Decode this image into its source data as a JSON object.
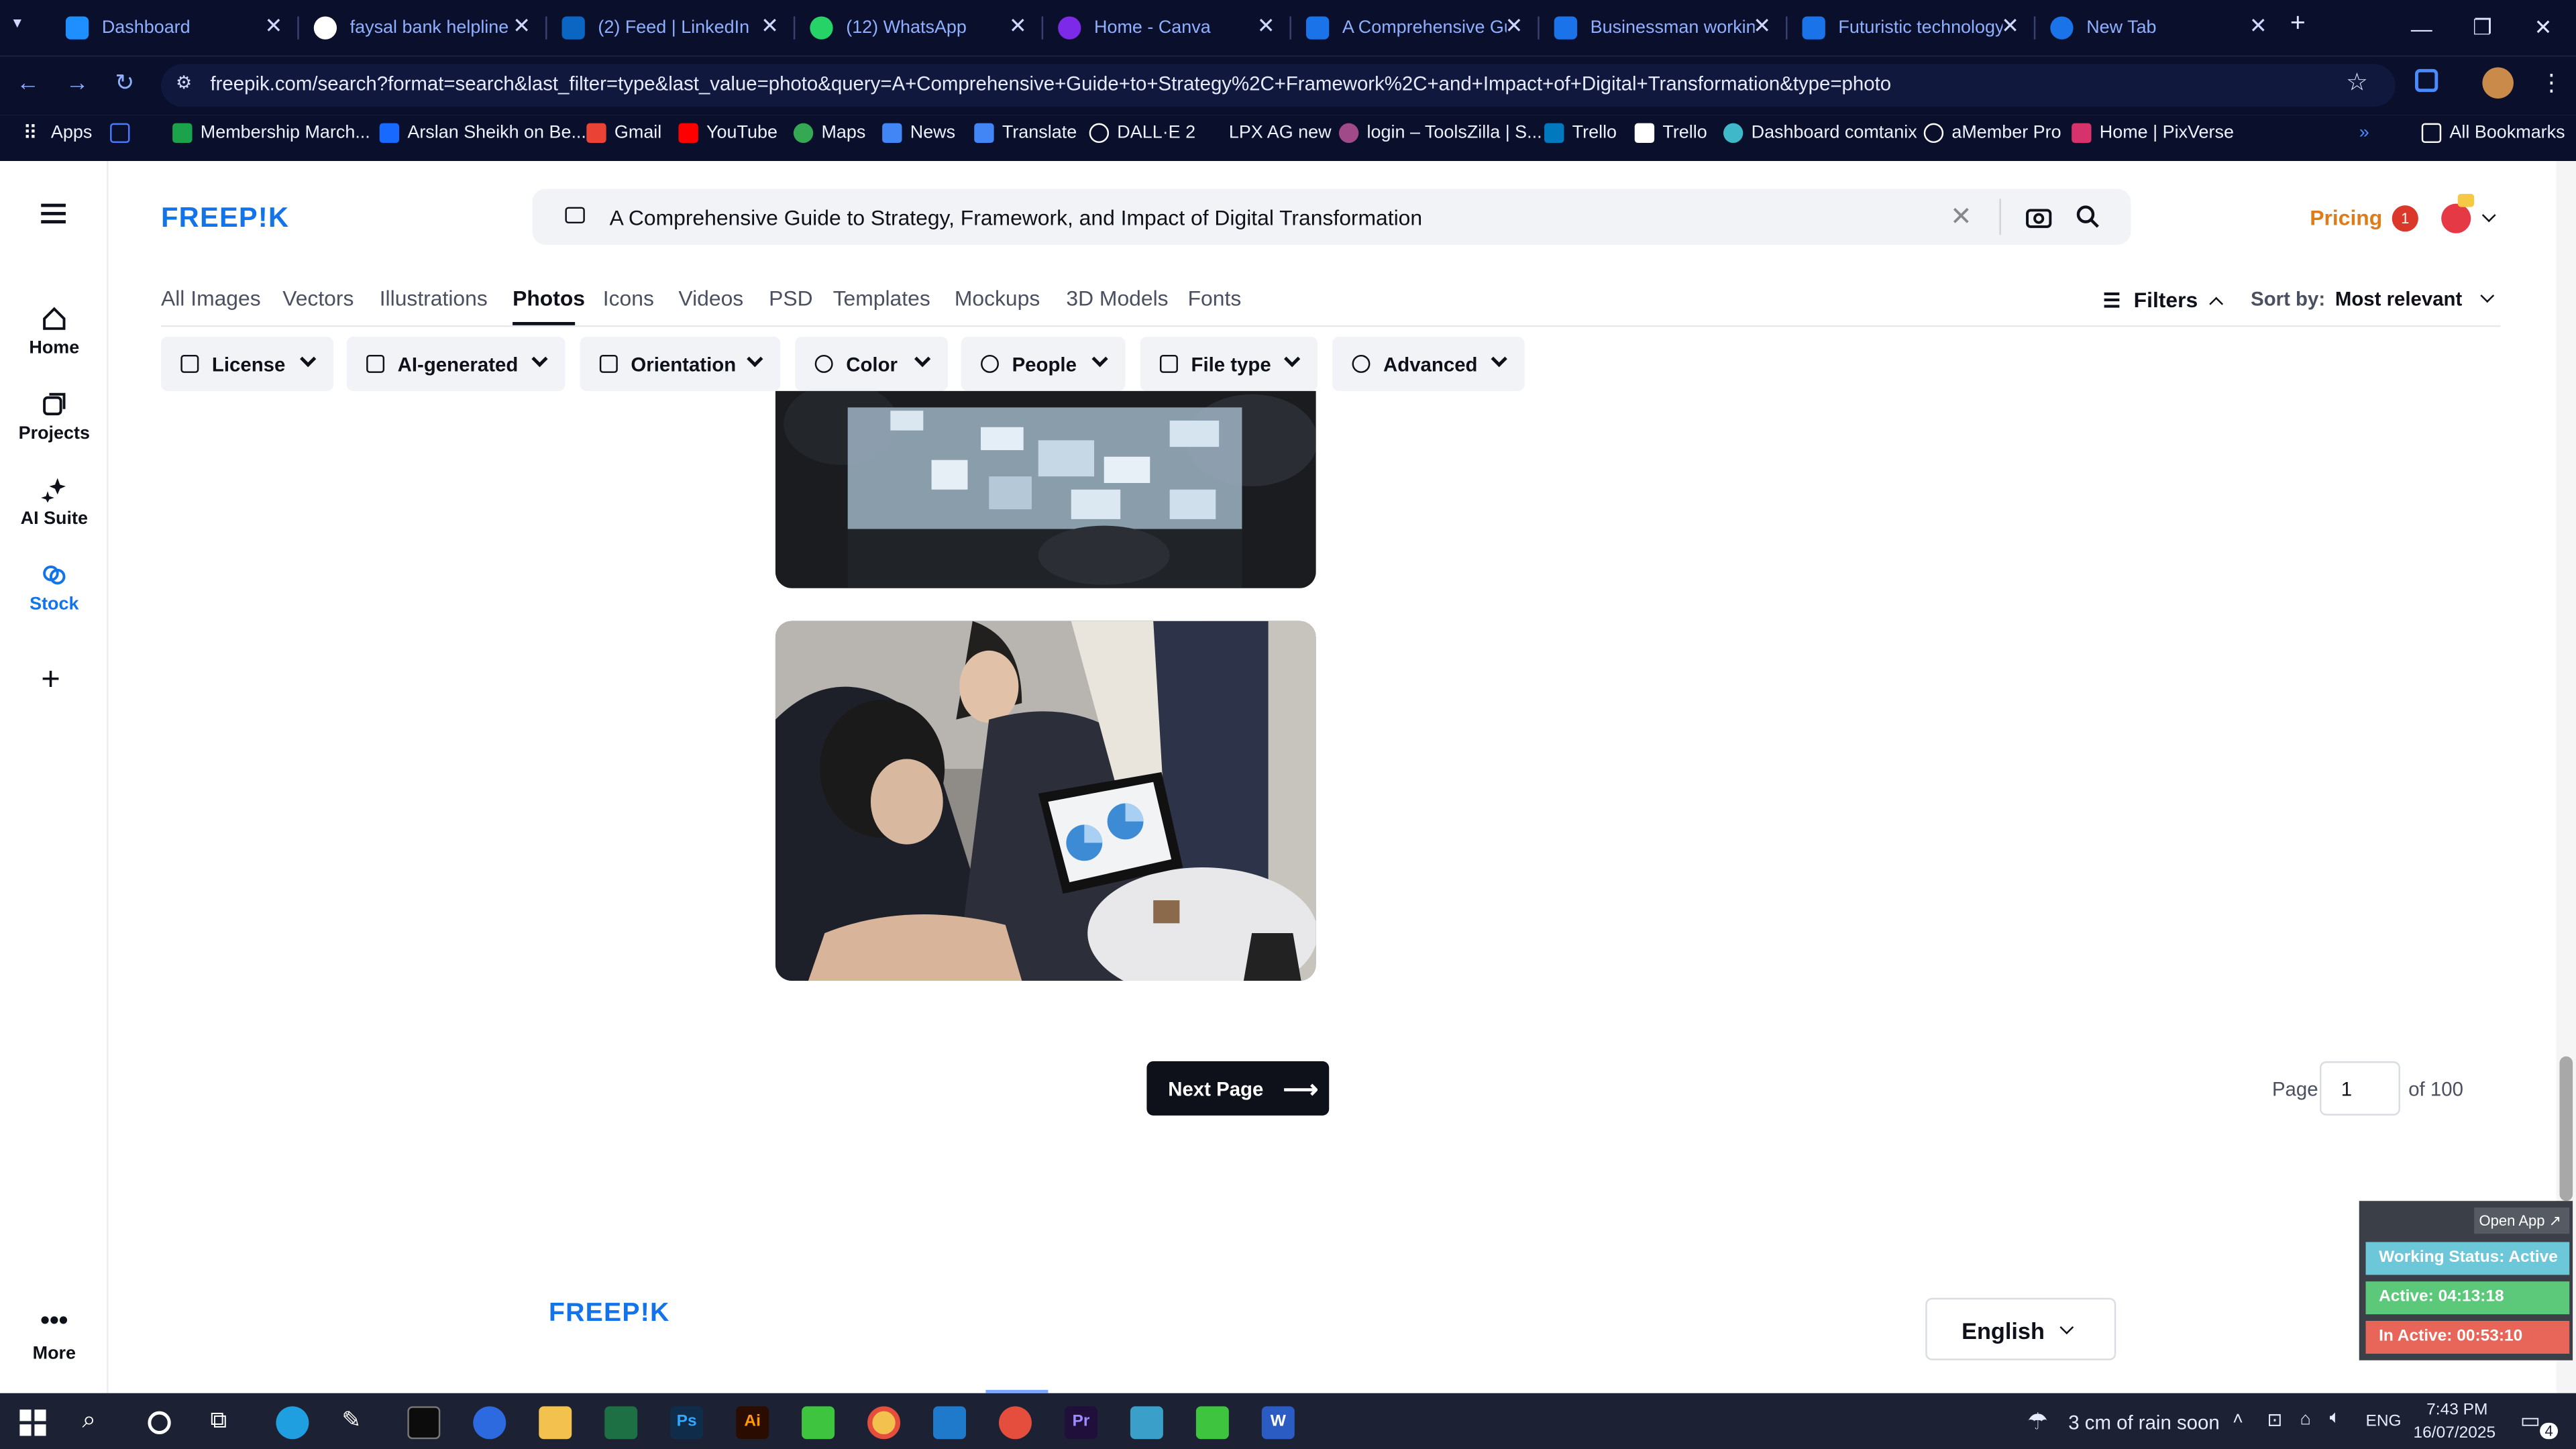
{
  "browser": {
    "tabs": [
      {
        "title": "Dashboard",
        "color": "#1f8fff"
      },
      {
        "title": "faysal bank helpline -",
        "color": "#ffffff"
      },
      {
        "title": "(2) Feed | LinkedIn",
        "color": "#0a66c2"
      },
      {
        "title": "(12) WhatsApp",
        "color": "#25d366"
      },
      {
        "title": "Home - Canva",
        "color": "#7d2ae8"
      },
      {
        "title": "A Comprehensive Gu",
        "color": "#1a73e8"
      },
      {
        "title": "Businessman working",
        "color": "#1a73e8"
      },
      {
        "title": "Futuristic technology",
        "color": "#1a73e8"
      },
      {
        "title": "New Tab",
        "color": "#1a73e8"
      }
    ],
    "new_tab_label": "+",
    "url": "freepik.com/search?format=search&last_filter=type&last_value=photo&query=A+Comprehensive+Guide+to+Strategy%2C+Framework%2C+and+Impact+of+Digital+Transformation&type=photo",
    "bookmarks": [
      {
        "label": "Apps",
        "color": "#ffffff"
      },
      {
        "label": "",
        "color": "#4a7bff"
      },
      {
        "label": "Membership March...",
        "color": "#1aa34a"
      },
      {
        "label": "Arslan Sheikh on Be...",
        "color": "#1769ff"
      },
      {
        "label": "Gmail",
        "color": "#ea4335"
      },
      {
        "label": "YouTube",
        "color": "#ff0000"
      },
      {
        "label": "Maps",
        "color": "#34a853"
      },
      {
        "label": "News",
        "color": "#4285f4"
      },
      {
        "label": "Translate",
        "color": "#4285f4"
      },
      {
        "label": "DALL·E 2",
        "color": "#ffffff"
      },
      {
        "label": "LPX AG new",
        "color": "#0a0f2c"
      },
      {
        "label": "login – ToolsZilla | S...",
        "color": "#a04a8a"
      },
      {
        "label": "Trello",
        "color": "#0079bf"
      },
      {
        "label": "Trello",
        "color": "#ffffff"
      },
      {
        "label": "Dashboard comtanix",
        "color": "#3fb8c9"
      },
      {
        "label": "aMember Pro",
        "color": "#ffffff"
      },
      {
        "label": "Home | PixVerse",
        "color": "#d6336c"
      }
    ],
    "all_bookmarks": "All Bookmarks"
  },
  "sidebar": {
    "items": [
      {
        "label": "Home",
        "icon": "home-icon"
      },
      {
        "label": "Projects",
        "icon": "projects-icon"
      },
      {
        "label": "AI Suite",
        "icon": "sparkle-icon"
      },
      {
        "label": "Stock",
        "icon": "stock-icon"
      },
      {
        "label": "",
        "icon": "plus-icon"
      }
    ],
    "more_label": "More"
  },
  "header": {
    "logo": "FREEP!K",
    "search_query": "A Comprehensive Guide to Strategy, Framework, and Impact of Digital Transformation",
    "pricing": "Pricing",
    "notification_count": "1"
  },
  "nav_tabs": [
    {
      "label": "All Images",
      "active": false
    },
    {
      "label": "Vectors",
      "active": false
    },
    {
      "label": "Illustrations",
      "active": false
    },
    {
      "label": "Photos",
      "active": true
    },
    {
      "label": "Icons",
      "active": false
    },
    {
      "label": "Videos",
      "active": false
    },
    {
      "label": "PSD",
      "active": false
    },
    {
      "label": "Templates",
      "active": false
    },
    {
      "label": "Mockups",
      "active": false
    },
    {
      "label": "3D Models",
      "active": false
    },
    {
      "label": "Fonts",
      "active": false
    }
  ],
  "filters_label": "Filters",
  "sort": {
    "label": "Sort by:",
    "value": "Most relevant"
  },
  "filter_buttons": [
    "License",
    "AI-generated",
    "Orientation",
    "Color",
    "People",
    "File type",
    "Advanced"
  ],
  "pagination": {
    "next_label": "Next Page",
    "page_label": "Page",
    "current_page": "1",
    "of_label": "of 100"
  },
  "footer": {
    "logo": "FREEP!K",
    "language": "English"
  },
  "widget": {
    "open_app": "Open App ↗",
    "status": "Working Status: Active",
    "active": "Active: 04:13:18",
    "inactive": "In Active: 00:53:10",
    "colors": {
      "status": "#6cc7d9",
      "active": "#5cc97a",
      "inactive": "#e8655a"
    }
  },
  "taskbar": {
    "weather": "3 cm of rain soon",
    "language": "ENG",
    "time": "7:43 PM",
    "date": "16/07/2025",
    "notifications": "4"
  }
}
